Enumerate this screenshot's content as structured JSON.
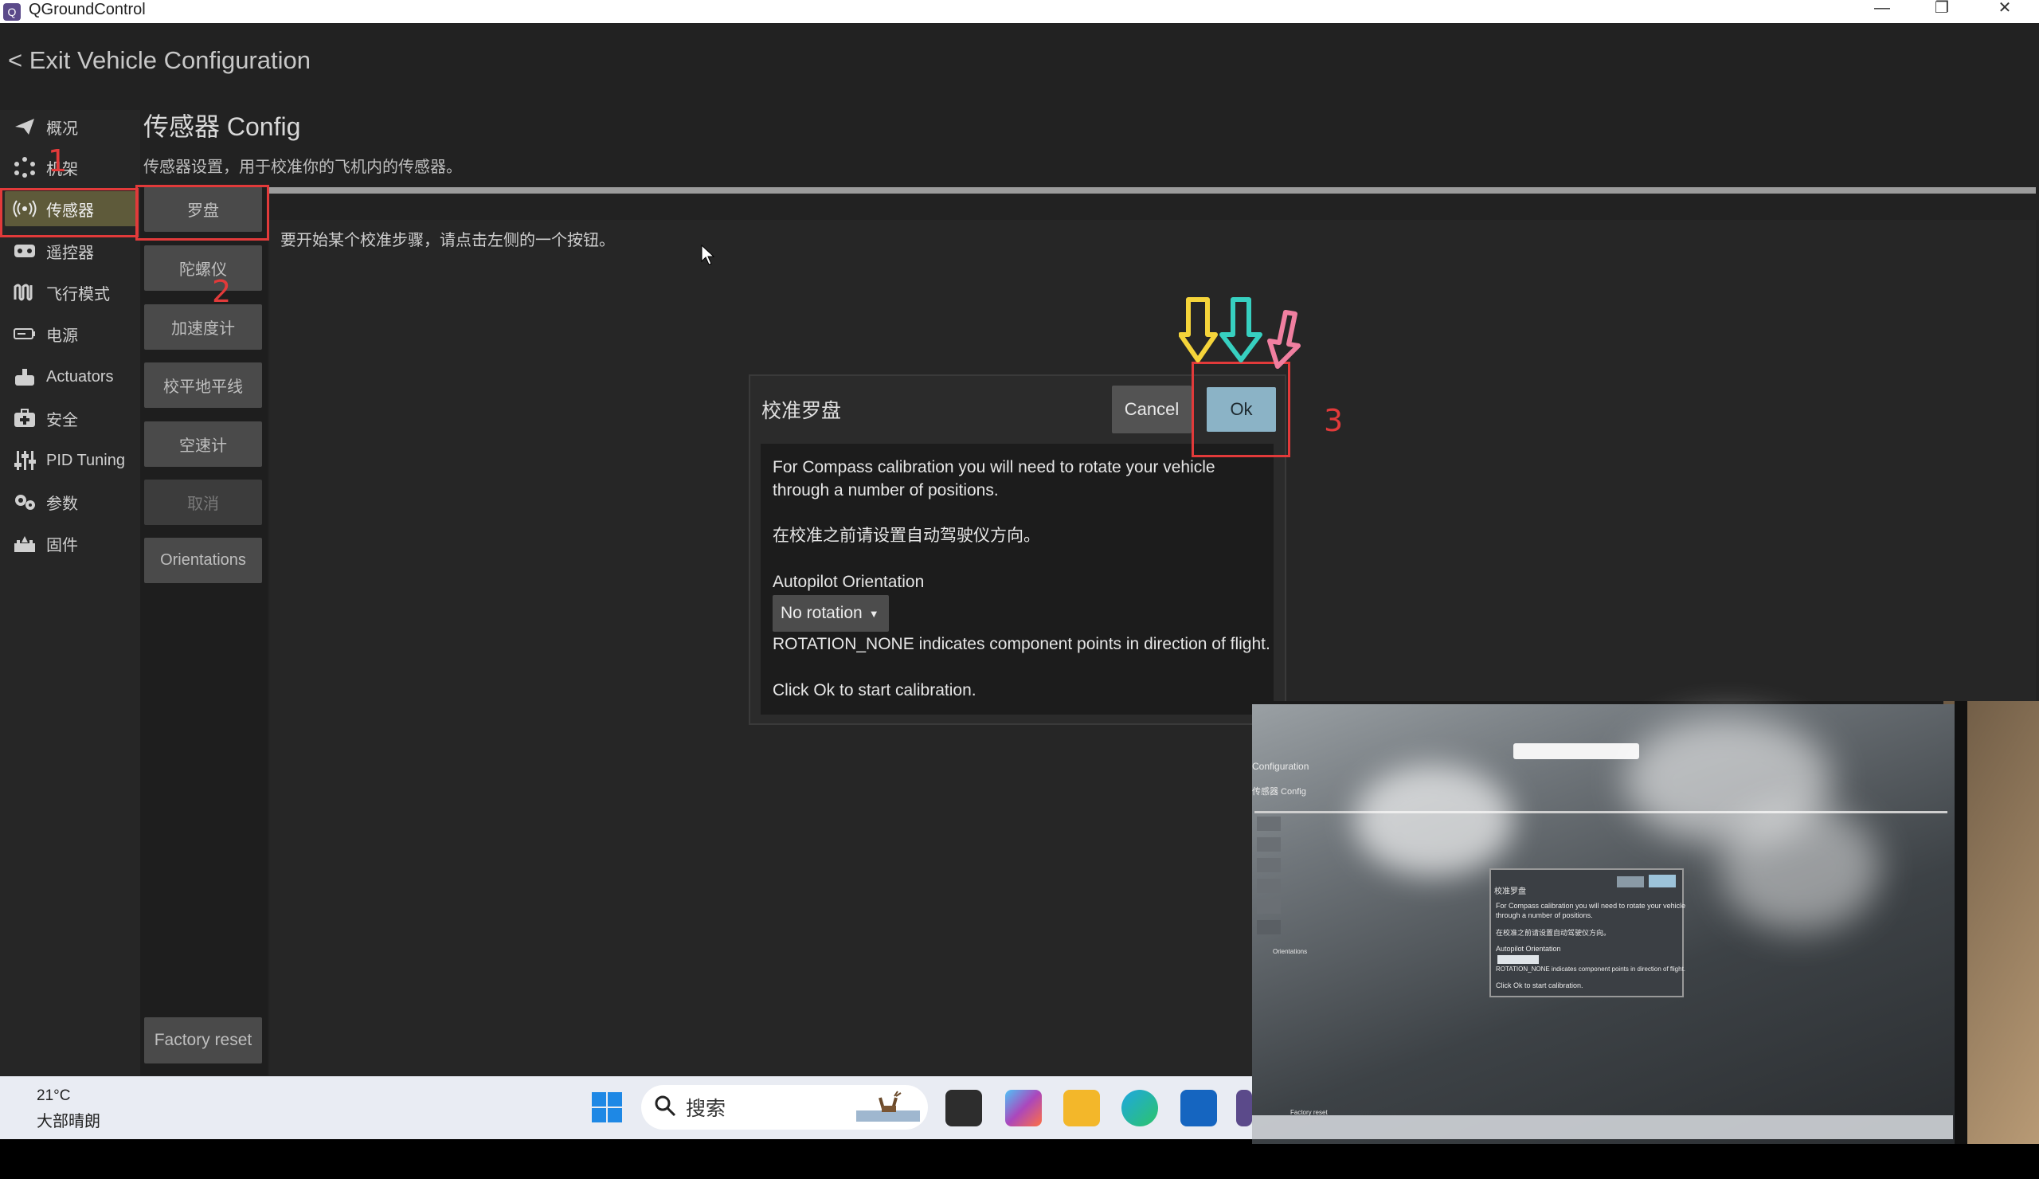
{
  "window": {
    "title": "QGroundControl",
    "minimize": "—",
    "maximize": "❐",
    "close": "✕"
  },
  "header": {
    "exit_label": "< Exit Vehicle Configuration"
  },
  "nav": {
    "items": [
      {
        "label": "概况",
        "icon": "paper-plane-icon"
      },
      {
        "label": "机架",
        "icon": "frame-dots-icon"
      },
      {
        "label": "传感器",
        "icon": "radio-waves-icon",
        "active": true
      },
      {
        "label": "遥控器",
        "icon": "gamepad-icon"
      },
      {
        "label": "飞行模式",
        "icon": "wave-icon"
      },
      {
        "label": "电源",
        "icon": "battery-icon"
      },
      {
        "label": "Actuators",
        "icon": "actuator-icon"
      },
      {
        "label": "安全",
        "icon": "first-aid-icon"
      },
      {
        "label": "PID Tuning",
        "icon": "sliders-icon"
      },
      {
        "label": "参数",
        "icon": "gears-icon"
      },
      {
        "label": "固件",
        "icon": "firmware-icon"
      }
    ]
  },
  "page": {
    "title": "传感器 Config",
    "description": "传感器设置，用于校准你的飞机内的传感器。",
    "hint": "要开始某个校准步骤，请点击左侧的一个按钮。"
  },
  "sensors": {
    "buttons": [
      "罗盘",
      "陀螺仪",
      "加速度计",
      "校平地平线",
      "空速计",
      "取消",
      "Orientations"
    ],
    "factory_reset": "Factory reset"
  },
  "dialog": {
    "title": "校准罗盘",
    "cancel": "Cancel",
    "ok": "Ok",
    "line1": "For Compass calibration you will need to rotate your vehicle",
    "line2": "through a number of positions.",
    "line3": "在校准之前请设置自动驾驶仪方向。",
    "orientation_label": "Autopilot Orientation",
    "orientation_value": "No rotation",
    "rotation_note": "ROTATION_NONE indicates component points in direction of flight.",
    "start_note": "Click Ok to start calibration."
  },
  "annotations": {
    "step1": "1",
    "step2": "2",
    "step3": "3"
  },
  "taskbar": {
    "temperature": "21°C",
    "weather": "大部晴朗",
    "search_label": "搜索"
  },
  "camera_overlay": {
    "config_text": "Configuration",
    "page_title": "传感器 Config",
    "dialog_title": "校准罗盘",
    "dialog_line1": "For Compass calibration you will need to rotate your vehicle",
    "dialog_line2": "through a number of positions.",
    "dialog_line3": "在校准之前请设置自动驾驶仪方向。",
    "orientation_label": "Autopilot Orientation",
    "rotation_note": "ROTATION_NONE indicates component points in direction of flight.",
    "start_note": "Click Ok to start calibration.",
    "factory_reset": "Factory reset",
    "orientations": "Orientations"
  },
  "colors": {
    "annotation_red": "#e23a3a",
    "ok_button": "#8bb3c6",
    "active_nav": "#5e5a3a",
    "arrow_yellow": "#f5d43a",
    "arrow_cyan": "#37d0c0",
    "arrow_pink": "#f07fa0"
  }
}
